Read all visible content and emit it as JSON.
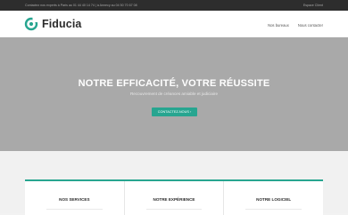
{
  "topbar": {
    "contact": "Contactez nos experts à Paris au 01 44 40 14 74  |  à Annecy au 04 50 70 67 08",
    "client_space": "Espace Client"
  },
  "header": {
    "logo_text": "Fiducia",
    "nav": [
      "Nos bureaux",
      "Nous contacter"
    ]
  },
  "hero": {
    "title": "NOTRE EFFICACITÉ, VOTRE RÉUSSITE",
    "subtitle": "Recouvrement de créances amiable et judiciaire",
    "cta": "CONTACTEZ-NOUS ›"
  },
  "services": {
    "cards": [
      {
        "title": "NOS SERVICES"
      },
      {
        "title": "NOTRE EXPÉRIENCE"
      },
      {
        "title": "NOTRE LOGICIEL"
      }
    ]
  },
  "colors": {
    "accent": "#27a590",
    "topbar": "#2d2d2d",
    "hero_bg": "#a9a9a9"
  }
}
